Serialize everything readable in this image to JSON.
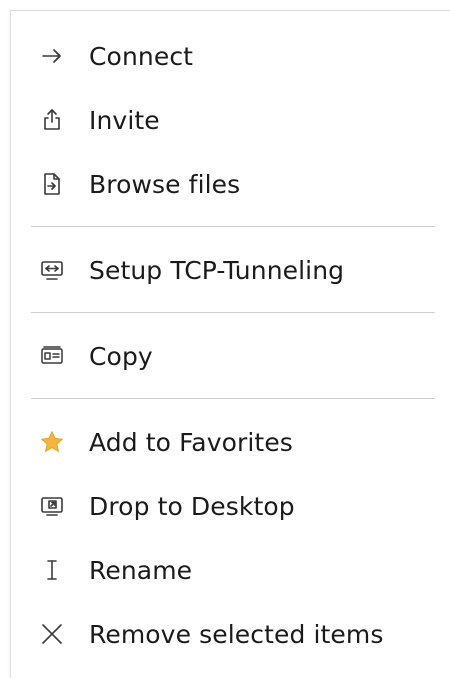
{
  "menu": {
    "items": [
      {
        "label": "Connect",
        "icon": "arrow-right-icon"
      },
      {
        "label": "Invite",
        "icon": "share-upload-icon"
      },
      {
        "label": "Browse files",
        "icon": "file-arrow-icon"
      },
      {
        "label": "Setup TCP-Tunneling",
        "icon": "tunnel-icon"
      },
      {
        "label": "Copy",
        "icon": "id-card-icon"
      },
      {
        "label": "Add to Favorites",
        "icon": "star-icon"
      },
      {
        "label": "Drop to Desktop",
        "icon": "desktop-shortcut-icon"
      },
      {
        "label": "Rename",
        "icon": "text-cursor-icon"
      },
      {
        "label": "Remove selected items",
        "icon": "close-x-icon"
      }
    ]
  },
  "colors": {
    "text": "#1b1b1b",
    "icon": "#3a3a3a",
    "star": "#f2b63a",
    "separator": "#cfcfcf"
  }
}
